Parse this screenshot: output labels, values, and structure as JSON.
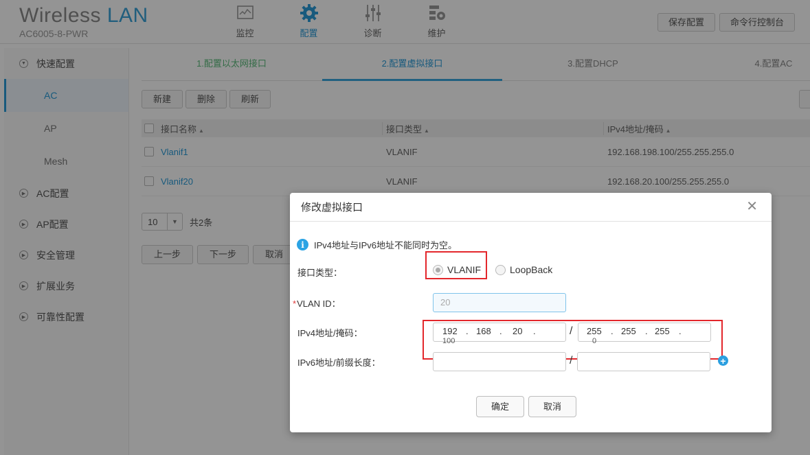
{
  "header": {
    "brand_word1": "Wireless",
    "brand_word2": "LAN",
    "model": "AC6005-8-PWR",
    "nav": [
      {
        "label": "监控",
        "icon": "monitor-icon"
      },
      {
        "label": "配置",
        "icon": "gear-icon"
      },
      {
        "label": "诊断",
        "icon": "sliders-icon"
      },
      {
        "label": "维护",
        "icon": "maintenance-icon"
      }
    ],
    "save_config": "保存配置",
    "cli_console": "命令行控制台"
  },
  "sidebar": {
    "quick_config": "快速配置",
    "sub_items": [
      "AC",
      "AP",
      "Mesh"
    ],
    "groups": [
      "AC配置",
      "AP配置",
      "安全管理",
      "扩展业务",
      "可靠性配置"
    ]
  },
  "steps": [
    "1.配置以太网接口",
    "2.配置虚拟接口",
    "3.配置DHCP",
    "4.配置AC"
  ],
  "toolbar": {
    "new": "新建",
    "delete": "删除",
    "refresh": "刷新"
  },
  "table": {
    "columns": [
      "接口名称",
      "接口类型",
      "IPv4地址/掩码"
    ],
    "rows": [
      {
        "name": "Vlanif1",
        "type": "VLANIF",
        "ip": "192.168.198.100/255.255.255.0"
      },
      {
        "name": "Vlanif20",
        "type": "VLANIF",
        "ip": "192.168.20.100/255.255.255.0"
      }
    ]
  },
  "pager": {
    "page_size": "10",
    "total": "共2条"
  },
  "wizard": {
    "prev": "上一步",
    "next": "下一步",
    "cancel": "取消"
  },
  "dialog": {
    "title": "修改虚拟接口",
    "close": "✕",
    "notice": "IPv4地址与IPv6地址不能同时为空。",
    "iface_type_label": "接口类型：",
    "iface_type_options": [
      "VLANIF",
      "LoopBack"
    ],
    "iface_type_selected": "VLANIF",
    "vlan_label": "VLAN ID：",
    "vlan_required": "*",
    "vlan_value": "20",
    "ipv4_label": "IPv4地址/掩码：",
    "ipv4_address": [
      "192",
      "168",
      "20",
      "100"
    ],
    "ipv4_mask": [
      "255",
      "255",
      "255",
      "0"
    ],
    "ipv6_label": "IPv6地址/前缀长度：",
    "ipv6_address": "",
    "ipv6_prefix": "",
    "slash": "/",
    "confirm": "确定",
    "cancel": "取消",
    "highlight_color": "#e3262b"
  }
}
